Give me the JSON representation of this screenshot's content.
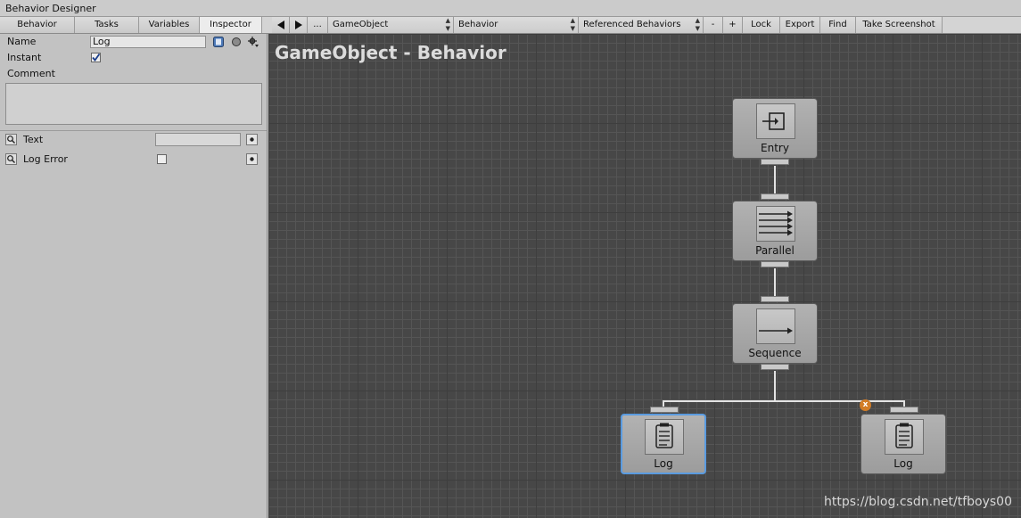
{
  "window": {
    "title": "Behavior Designer"
  },
  "toolbar": {
    "tabs": [
      "Behavior",
      "Tasks",
      "Variables",
      "Inspector"
    ],
    "active_tab": "Inspector",
    "prev_icon": "triangle-left-icon",
    "next_icon": "triangle-right-icon",
    "more_label": "...",
    "object_dropdown": "GameObject",
    "behavior_dropdown": "Behavior",
    "referenced_dropdown": "Referenced Behaviors",
    "minus_label": "-",
    "plus_label": "+",
    "lock_label": "Lock",
    "export_label": "Export",
    "find_label": "Find",
    "screenshot_label": "Take Screenshot"
  },
  "inspector": {
    "name_label": "Name",
    "name_value": "Log",
    "instant_label": "Instant",
    "instant_checked": true,
    "comment_label": "Comment",
    "comment_value": "",
    "fields": [
      {
        "label": "Text",
        "type": "text",
        "value": ""
      },
      {
        "label": "Log Error",
        "type": "checkbox",
        "checked": false
      }
    ]
  },
  "graph": {
    "title": "GameObject - Behavior",
    "nodes": [
      {
        "name": "Entry",
        "icon": "entry-icon"
      },
      {
        "name": "Parallel",
        "icon": "parallel-icon"
      },
      {
        "name": "Sequence",
        "icon": "sequence-icon"
      },
      {
        "name": "Log",
        "icon": "log-icon",
        "selected": true
      },
      {
        "name": "Log",
        "icon": "log-icon",
        "selected": false,
        "badge": "x"
      }
    ]
  },
  "watermark": "https://blog.csdn.net/tfboys00",
  "colors": {
    "canvas": "#474747",
    "selection": "#5a9be0",
    "badge": "#d27d27"
  }
}
